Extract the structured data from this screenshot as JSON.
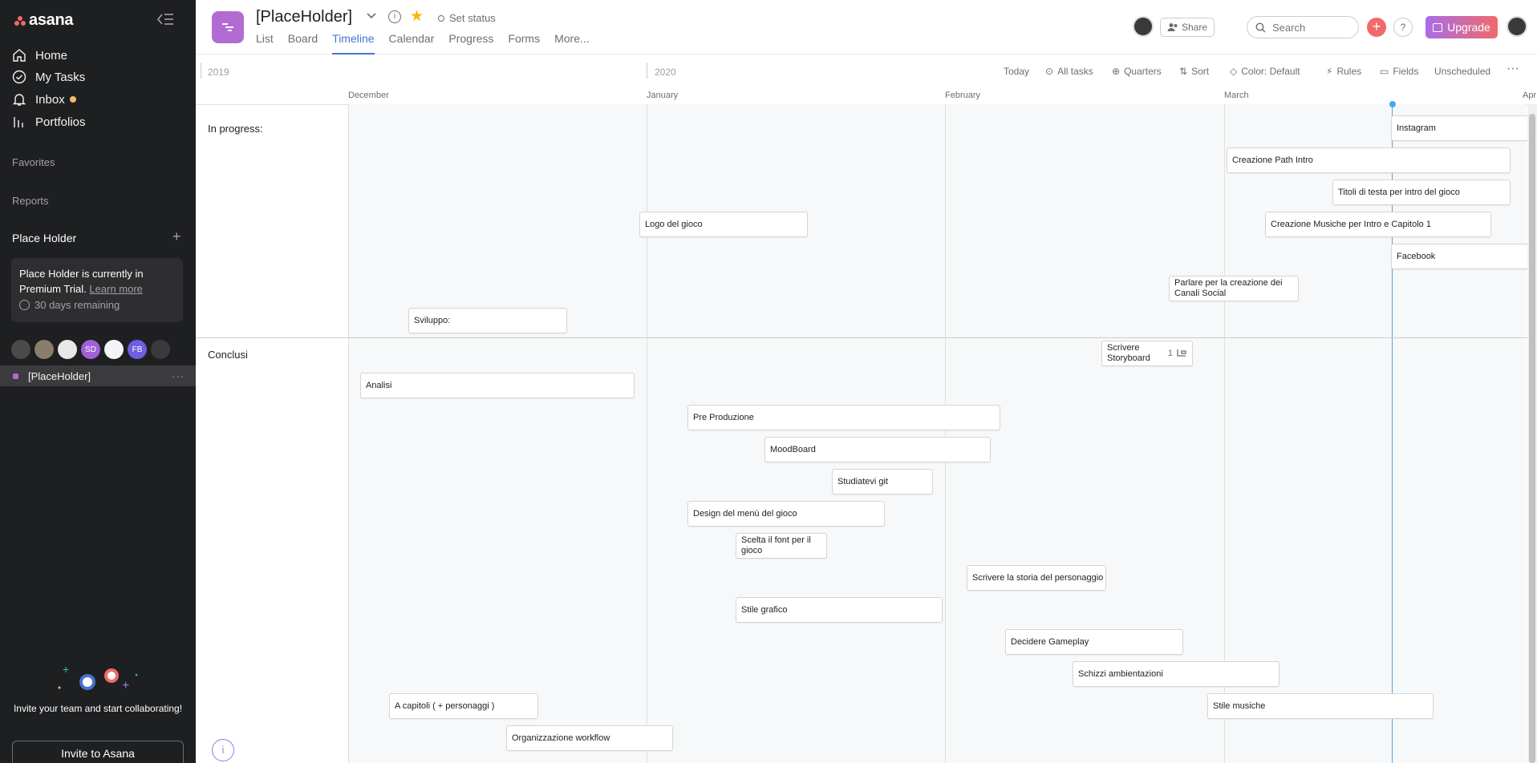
{
  "app": {
    "logo_text": "asana"
  },
  "sidebar": {
    "nav": [
      {
        "label": "Home",
        "icon": "home-icon"
      },
      {
        "label": "My Tasks",
        "icon": "check-circle-icon"
      },
      {
        "label": "Inbox",
        "icon": "bell-icon"
      },
      {
        "label": "Portfolios",
        "icon": "bar-chart-icon"
      }
    ],
    "favorites": "Favorites",
    "reports": "Reports",
    "team": "Place Holder",
    "trial": {
      "text": "Place Holder is currently in Premium Trial.",
      "link": "Learn more",
      "days": "30 days remaining"
    },
    "members": [
      {
        "initials": "",
        "color": "#4a4a4a"
      },
      {
        "initials": "",
        "color": "#8a7d6e"
      },
      {
        "initials": "",
        "color": "#e8e8e8"
      },
      {
        "initials": "SD",
        "color": "#a15fd8"
      },
      {
        "initials": "",
        "color": "#f4f4f4"
      },
      {
        "initials": "FB",
        "color": "#6f5ee0"
      },
      {
        "initials": "",
        "color": "#3a3a3d"
      }
    ],
    "project": "[PlaceHolder]",
    "invite_text": "Invite your team and start collaborating!",
    "invite_button": "Invite to Asana"
  },
  "header": {
    "title": "[PlaceHolder]",
    "status": "Set status",
    "tabs": [
      "List",
      "Board",
      "Timeline",
      "Calendar",
      "Progress",
      "Forms",
      "More..."
    ],
    "active_tab": "Timeline",
    "share": "Share",
    "search_placeholder": "Search",
    "upgrade": "Upgrade"
  },
  "toolbar": {
    "years": [
      "2019",
      "2020"
    ],
    "buttons": [
      "Today",
      "All tasks",
      "Quarters",
      "Sort",
      "Color: Default",
      "Rules",
      "Fields",
      "Unscheduled"
    ],
    "months": [
      "December",
      "January",
      "February",
      "March",
      "Apr"
    ]
  },
  "sections": [
    {
      "name": "In progress:"
    },
    {
      "name": "Conclusi"
    }
  ],
  "tasks": [
    {
      "name": "Instagram"
    },
    {
      "name": "Creazione Path Intro"
    },
    {
      "name": "Titoli di testa per intro del gioco"
    },
    {
      "name": "Logo del gioco"
    },
    {
      "name": "Creazione Musiche per Intro e Capitolo 1"
    },
    {
      "name": "Facebook"
    },
    {
      "name": "Parlare per la creazione dei Canali Social"
    },
    {
      "name": "Sviluppo:"
    },
    {
      "name": "Scrivere Storyboard",
      "subtasks": "1"
    },
    {
      "name": "Analisi"
    },
    {
      "name": "Pre Produzione"
    },
    {
      "name": "MoodBoard"
    },
    {
      "name": "Studiatevi git"
    },
    {
      "name": "Design del menù del gioco"
    },
    {
      "name": "Scelta il font per il gioco"
    },
    {
      "name": "Scrivere la storia del personaggio"
    },
    {
      "name": "Stile grafico"
    },
    {
      "name": "Decidere Gameplay"
    },
    {
      "name": "Schizzi ambientazioni"
    },
    {
      "name": "A capitoli ( + personaggi )"
    },
    {
      "name": "Stile musiche"
    },
    {
      "name": "Organizzazione workflow"
    }
  ]
}
